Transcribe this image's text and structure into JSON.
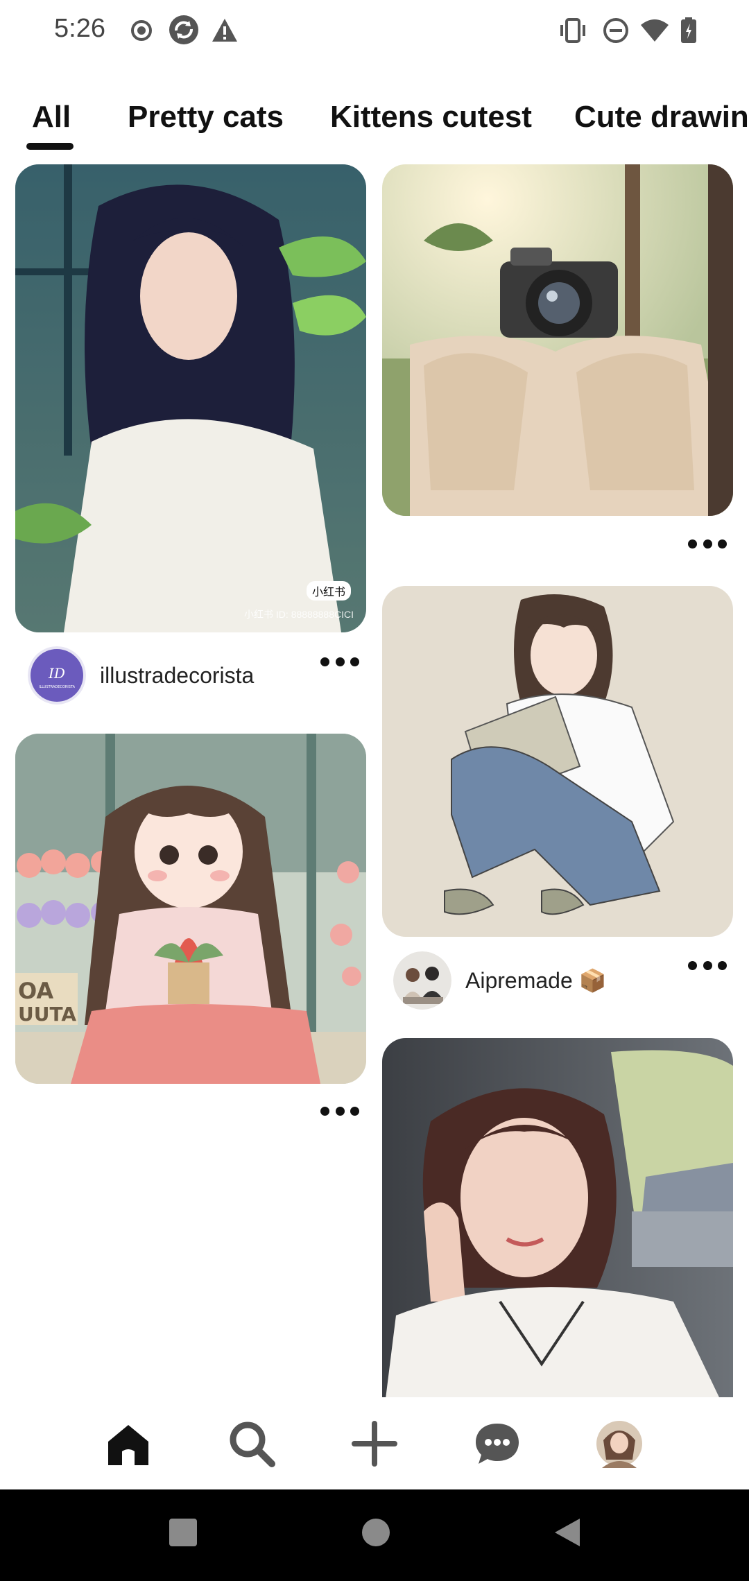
{
  "status_bar": {
    "time": "5:26",
    "left_icons": [
      "record-icon",
      "sync-icon",
      "warning-icon"
    ],
    "right_icons": [
      "vibrate-icon",
      "do-not-disturb-icon",
      "wifi-icon",
      "battery-icon"
    ]
  },
  "tabs": [
    {
      "label": "All",
      "selected": true
    },
    {
      "label": "Pretty cats",
      "selected": false
    },
    {
      "label": "Kittens cutest",
      "selected": false
    },
    {
      "label": "Cute drawing",
      "selected": false
    }
  ],
  "pins": {
    "pin1": {
      "creator": "illustradecorista",
      "avatar_text": "ILLUSTRADECORISTA",
      "watermark": "小红书 ID: 88888888CICI",
      "badge": "小红书"
    },
    "pin2": {
      "creator": ""
    },
    "pin3": {
      "creator": ""
    },
    "pin4": {
      "creator": "Aipremade 📦"
    },
    "pin5": {
      "creator": ""
    }
  },
  "bottom_nav": [
    "home-icon",
    "search-icon",
    "create-icon",
    "messages-icon",
    "profile-avatar"
  ],
  "colors": {
    "accent": "#111111",
    "background": "#ffffff",
    "system_nav": "#000000"
  }
}
